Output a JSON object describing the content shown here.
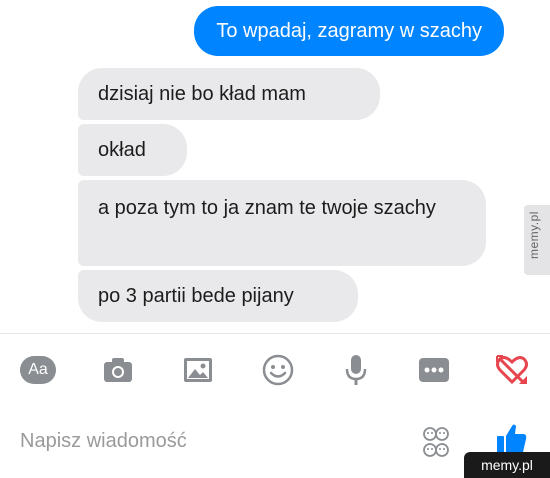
{
  "messages": [
    {
      "direction": "outgoing",
      "text": "To wpadaj, zagramy w szachy"
    },
    {
      "direction": "incoming",
      "text": "dzisiaj nie bo kład mam"
    },
    {
      "direction": "incoming",
      "text": "okład"
    },
    {
      "direction": "incoming",
      "text": "a poza tym to ja znam te twoje szachy"
    },
    {
      "direction": "incoming",
      "text": "po 3 partii bede pijany"
    }
  ],
  "toolbar": {
    "text_style_label": "Aa",
    "icons": [
      "text-style-icon",
      "camera-icon",
      "image-icon",
      "emoji-icon",
      "microphone-icon",
      "more-icon",
      "heart-arrow-icon"
    ]
  },
  "composer": {
    "placeholder": "Napisz wiadomość",
    "icons": [
      "stickers-icon",
      "thumbs-up-icon"
    ]
  },
  "watermarks": {
    "side": "memy.pl",
    "corner": "memy.pl"
  },
  "colors": {
    "outgoing_bubble": "#0084ff",
    "incoming_bubble": "#e9e9eb",
    "icon_gray": "#8a8d91",
    "accent_blue": "#0084ff",
    "heart_red": "#e8464f"
  }
}
